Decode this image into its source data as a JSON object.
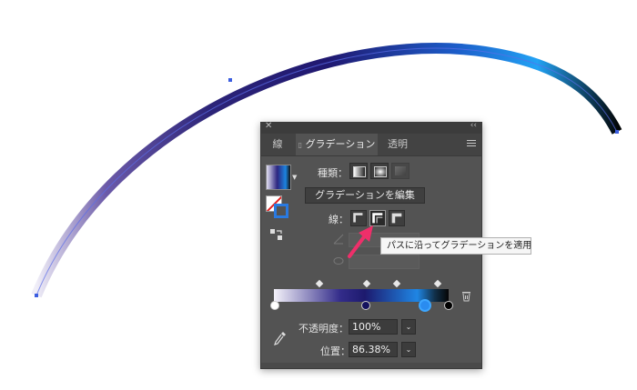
{
  "panel": {
    "close_glyph": "✕",
    "collapse_glyph": "‹‹",
    "tabs": {
      "stroke": "線",
      "gradient": "グラデーション",
      "opacity": "透明"
    },
    "type_label": "種類：",
    "edit_button": "グラデーションを編集",
    "stroke_label": "線：",
    "opacity_label": "不透明度：",
    "opacity_value": "100%",
    "location_label": "位置：",
    "location_value": "86.38%",
    "dropdown_glyph": "⌄"
  },
  "tooltip": {
    "text": "パスに沿ってグラデーションを適用"
  },
  "gradient": {
    "stops": [
      {
        "color": "#ffffff",
        "location": 0
      },
      {
        "color": "#14125e",
        "location": 52
      },
      {
        "color": "#2a8cf0",
        "location": 86.38
      },
      {
        "color": "#000000",
        "location": 100
      }
    ],
    "selected_stop": 2
  },
  "colors": {
    "accent": "#2a7ae0",
    "annotation_arrow": "#ee2f6a"
  }
}
